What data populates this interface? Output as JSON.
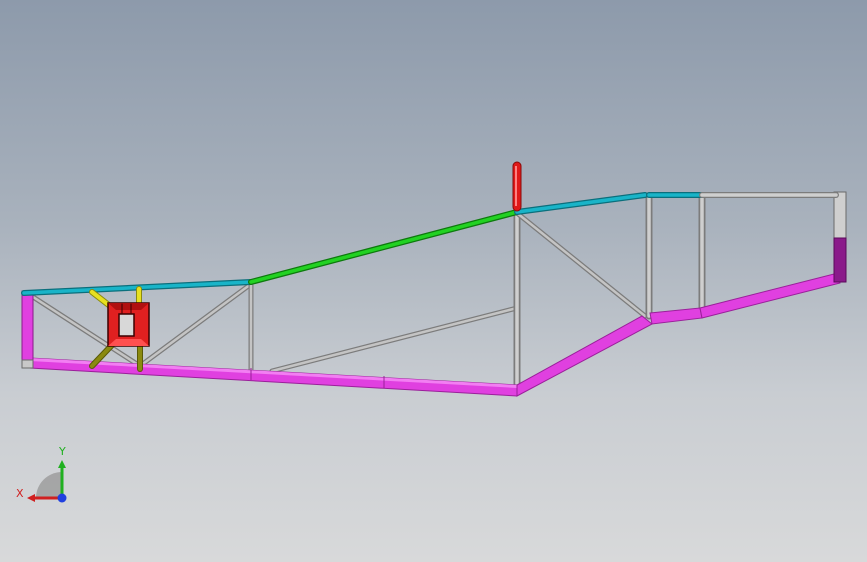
{
  "viewport": {
    "background_top": "#8d9aab",
    "background_bottom": "#d8d9da"
  },
  "model": {
    "name": "truss-frame",
    "colors": {
      "bottom_chord": "#e040e0",
      "bottom_chord_dark": "#9a209a",
      "top_chord_cyan": "#19b4c8",
      "top_chord_green": "#22d222",
      "web_member": "#b4b4b4",
      "end_post_dark": "#8a1a8a",
      "red_post": "#e01818",
      "fitting_red": "#e02020",
      "yellow_brace": "#e8e020",
      "olive_brace": "#8a8a10"
    }
  },
  "triad": {
    "x_label": "X",
    "y_label": "Y",
    "x_color": "#d02020",
    "y_color": "#20b020",
    "z_color": "#2040e0"
  }
}
